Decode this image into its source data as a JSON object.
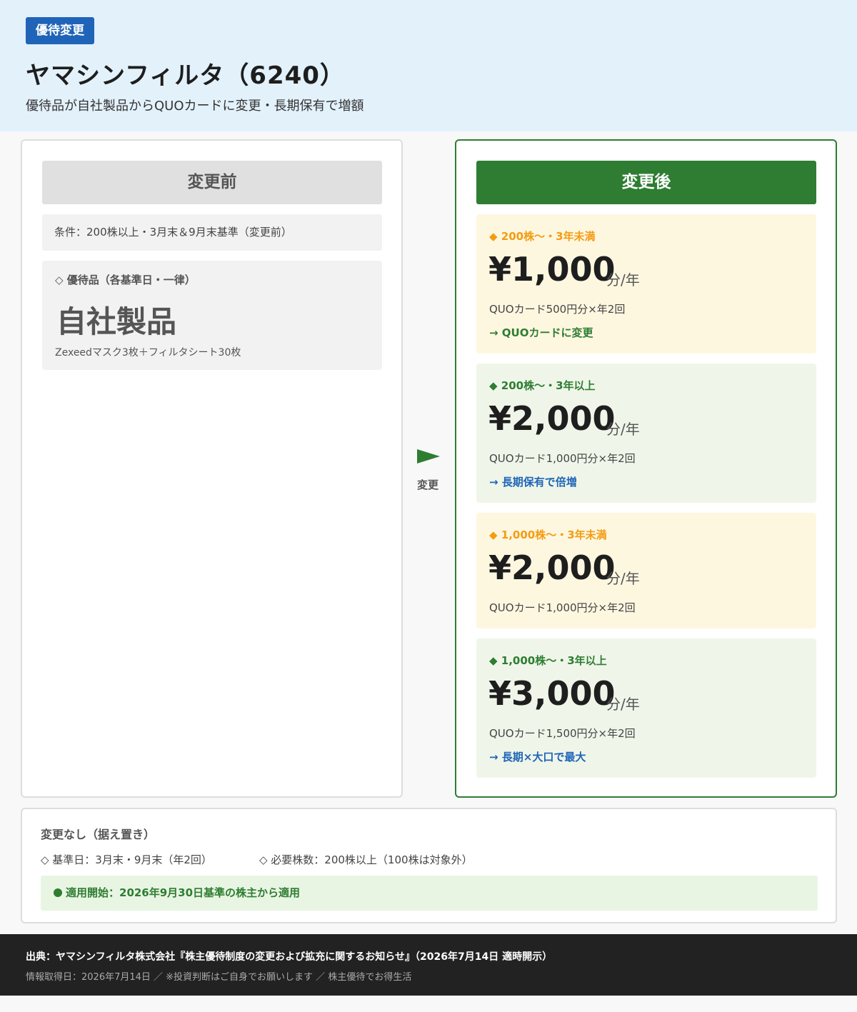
{
  "header": {
    "badge": "優待変更",
    "title": "ヤマシンフィルタ（6240）",
    "subtitle": "優待品が自社製品からQUOカードに変更・長期保有で増額"
  },
  "before": {
    "heading": "変更前",
    "condition": "条件：200株以上・3月末＆9月末基準（変更前）",
    "item_label": "◇ 優待品（各基準日・一律）",
    "item_name": "自社製品",
    "item_desc": "Zexeedマスク3枚＋フィルタシート30枚"
  },
  "arrow": {
    "label": "変更"
  },
  "after": {
    "heading": "変更後",
    "tiers": [
      {
        "label": "◆ 200株〜・3年未満",
        "amount": "¥1,000",
        "unit": "分/年",
        "detail": "QUOカード500円分×年2回",
        "note": "→ QUOカードに変更"
      },
      {
        "label": "◆ 200株〜・3年以上",
        "amount": "¥2,000",
        "unit": "分/年",
        "detail": "QUOカード1,000円分×年2回",
        "note": "→ 長期保有で倍増"
      },
      {
        "label": "◆ 1,000株〜・3年未満",
        "amount": "¥2,000",
        "unit": "分/年",
        "detail": "QUOカード1,000円分×年2回"
      },
      {
        "label": "◆ 1,000株〜・3年以上",
        "amount": "¥3,000",
        "unit": "分/年",
        "detail": "QUOカード1,500円分×年2回",
        "note": "→ 長期×大口で最大"
      }
    ]
  },
  "unchanged": {
    "title": "変更なし（据え置き）",
    "record_date": "◇ 基準日：3月末・9月末（年2回）",
    "required_shares": "◇ 必要株数：200株以上（100株は対象外）",
    "start": "適用開始：2026年9月30日基準の株主から適用"
  },
  "footer": {
    "source": "出典：ヤマシンフィルタ株式会社『株主優待制度の変更および拡充に関するお知らせ』（2026年7月14日 適時開示）",
    "info": "情報取得日：2026年7月14日 ／ ※投資判断はご自身でお願いします ／ 株主優待でお得生活"
  },
  "colors": {
    "brand_blue": "#1f64b8",
    "green": "#2e7d32",
    "orange": "#f39c12",
    "header_bg": "#e3f1fb"
  }
}
